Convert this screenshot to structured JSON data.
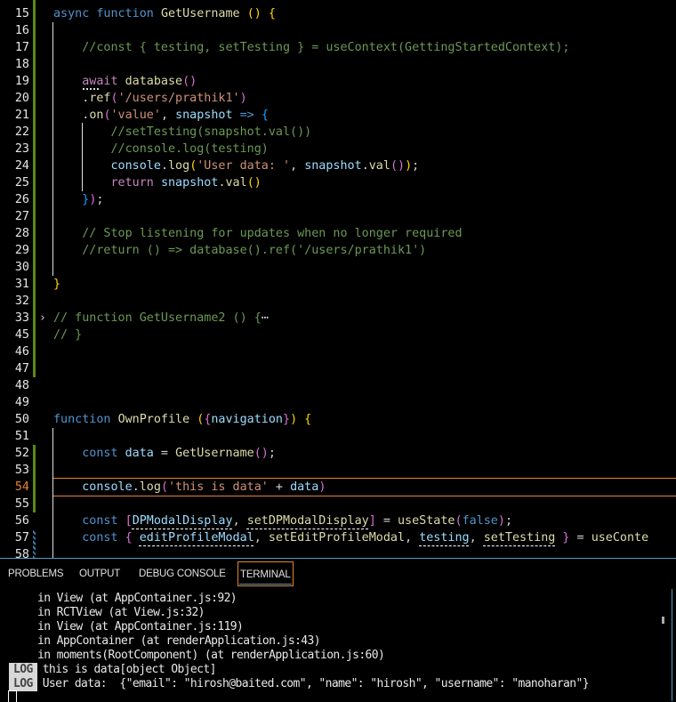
{
  "editor": {
    "active_line": "54",
    "lines": [
      {
        "n": "15",
        "tokens": [
          [
            "k",
            "async "
          ],
          [
            "k",
            "function "
          ],
          [
            "f",
            "GetUsername "
          ],
          [
            "p",
            "() {"
          ]
        ]
      },
      {
        "n": "16",
        "tokens": []
      },
      {
        "n": "17",
        "tokens": [
          [
            "c",
            "    //const { testing, setTesting } = useContext(GettingStartedContext);"
          ]
        ]
      },
      {
        "n": "18",
        "tokens": []
      },
      {
        "n": "19",
        "tokens": [
          [
            "w",
            "    "
          ],
          [
            "ctl",
            "await"
          ],
          [
            "w",
            " "
          ],
          [
            "f",
            "database"
          ],
          [
            "pp",
            "()"
          ]
        ]
      },
      {
        "n": "20",
        "tokens": [
          [
            "w",
            "    ."
          ],
          [
            "f",
            "ref"
          ],
          [
            "pp",
            "("
          ],
          [
            "s",
            "'/users/prathik1'"
          ],
          [
            "pp",
            ")"
          ]
        ]
      },
      {
        "n": "21",
        "tokens": [
          [
            "w",
            "    ."
          ],
          [
            "f",
            "on"
          ],
          [
            "pp",
            "("
          ],
          [
            "s",
            "'value'"
          ],
          [
            "w",
            ", "
          ],
          [
            "v",
            "snapshot"
          ],
          [
            "w",
            " "
          ],
          [
            "k",
            "=>"
          ],
          [
            "w",
            " "
          ],
          [
            "pb",
            "{"
          ]
        ]
      },
      {
        "n": "22",
        "tokens": [
          [
            "c",
            "        //setTesting(snapshot.val())"
          ]
        ]
      },
      {
        "n": "23",
        "tokens": [
          [
            "c",
            "        //console.log(testing)"
          ]
        ]
      },
      {
        "n": "24",
        "tokens": [
          [
            "w",
            "        "
          ],
          [
            "v",
            "console"
          ],
          [
            "w",
            "."
          ],
          [
            "f",
            "log"
          ],
          [
            "p",
            "("
          ],
          [
            "s",
            "'User data: '"
          ],
          [
            "w",
            ", "
          ],
          [
            "v",
            "snapshot"
          ],
          [
            "w",
            "."
          ],
          [
            "f",
            "val"
          ],
          [
            "pp",
            "()"
          ],
          [
            "p",
            ")"
          ],
          [
            "w",
            ";"
          ]
        ]
      },
      {
        "n": "25",
        "tokens": [
          [
            "w",
            "        "
          ],
          [
            "ctl",
            "return"
          ],
          [
            "w",
            " "
          ],
          [
            "v",
            "snapshot"
          ],
          [
            "w",
            "."
          ],
          [
            "f",
            "val"
          ],
          [
            "p",
            "()"
          ]
        ]
      },
      {
        "n": "26",
        "tokens": [
          [
            "w",
            "    "
          ],
          [
            "pb",
            "}"
          ],
          [
            "pp",
            ")"
          ],
          [
            "w",
            ";"
          ]
        ]
      },
      {
        "n": "27",
        "tokens": []
      },
      {
        "n": "28",
        "tokens": [
          [
            "c",
            "    // Stop listening for updates when no longer required"
          ]
        ]
      },
      {
        "n": "29",
        "tokens": [
          [
            "c",
            "    //return () => database().ref('/users/prathik1')"
          ]
        ]
      },
      {
        "n": "30",
        "tokens": []
      },
      {
        "n": "31",
        "tokens": [
          [
            "p",
            "}"
          ]
        ]
      },
      {
        "n": "32",
        "tokens": []
      },
      {
        "n": "33",
        "tokens": [
          [
            "c",
            "// function GetUsername2 () {"
          ],
          [
            "w",
            "⋯"
          ]
        ],
        "folded": true
      },
      {
        "n": "45",
        "tokens": [
          [
            "c",
            "// }"
          ]
        ]
      },
      {
        "n": "46",
        "tokens": []
      },
      {
        "n": "47",
        "tokens": []
      },
      {
        "n": "48",
        "tokens": []
      },
      {
        "n": "49",
        "tokens": []
      },
      {
        "n": "50",
        "tokens": [
          [
            "k",
            "function "
          ],
          [
            "f",
            "OwnProfile "
          ],
          [
            "p",
            "("
          ],
          [
            "pp",
            "{"
          ],
          [
            "v",
            "navigation"
          ],
          [
            "pp",
            "}"
          ],
          [
            "p",
            ") {"
          ]
        ]
      },
      {
        "n": "51",
        "tokens": []
      },
      {
        "n": "52",
        "tokens": [
          [
            "w",
            "    "
          ],
          [
            "k",
            "const "
          ],
          [
            "v",
            "data"
          ],
          [
            "w",
            " = "
          ],
          [
            "f",
            "GetUsername"
          ],
          [
            "pp",
            "()"
          ],
          [
            "w",
            ";"
          ]
        ]
      },
      {
        "n": "53",
        "tokens": []
      },
      {
        "n": "54",
        "tokens": [
          [
            "w",
            "    "
          ],
          [
            "v",
            "console"
          ],
          [
            "w",
            "."
          ],
          [
            "f",
            "log"
          ],
          [
            "pp",
            "("
          ],
          [
            "s",
            "'this is data'"
          ],
          [
            "w",
            " + "
          ],
          [
            "v",
            "data"
          ],
          [
            "pp",
            ")"
          ]
        ]
      },
      {
        "n": "55",
        "tokens": []
      },
      {
        "n": "56",
        "tokens": [
          [
            "w",
            "    "
          ],
          [
            "k",
            "const "
          ],
          [
            "pp",
            "["
          ],
          [
            "v",
            "DPModalDisplay"
          ],
          [
            "w",
            ", "
          ],
          [
            "f",
            "setDPModalDisplay"
          ],
          [
            "pp",
            "]"
          ],
          [
            "w",
            " = "
          ],
          [
            "f",
            "useState"
          ],
          [
            "pp",
            "("
          ],
          [
            "k",
            "false"
          ],
          [
            "pp",
            ")"
          ],
          [
            "w",
            ";"
          ]
        ]
      },
      {
        "n": "57",
        "tokens": [
          [
            "w",
            "    "
          ],
          [
            "k",
            "const "
          ],
          [
            "pp",
            "{ "
          ],
          [
            "v",
            "editProfileModal"
          ],
          [
            "w",
            ", "
          ],
          [
            "f",
            "setEditProfileModal"
          ],
          [
            "w",
            ", "
          ],
          [
            "v",
            "testing"
          ],
          [
            "w",
            ", "
          ],
          [
            "f",
            "setTesting"
          ],
          [
            "pp",
            " }"
          ],
          [
            "w",
            " = "
          ],
          [
            "f",
            "useConte"
          ]
        ]
      },
      {
        "n": "58",
        "tokens": []
      }
    ]
  },
  "panel": {
    "tabs": [
      {
        "label": "PROBLEMS",
        "active": false
      },
      {
        "label": "OUTPUT",
        "active": false
      },
      {
        "label": "DEBUG CONSOLE",
        "active": false
      },
      {
        "label": "TERMINAL",
        "active": true
      }
    ]
  },
  "terminal": {
    "lines": [
      {
        "text": "in View (at AppContainer.js:92)"
      },
      {
        "text": "in RCTView (at View.js:32)"
      },
      {
        "text": "in View (at AppContainer.js:119)"
      },
      {
        "text": "in AppContainer (at renderApplication.js:43)"
      },
      {
        "text": "in moments(RootComponent) (at renderApplication.js:60)"
      },
      {
        "badge": "LOG",
        "text": "this is data[object Object]"
      },
      {
        "badge": "LOG",
        "text": "User data:  {\"email\": \"hirosh@baited.com\", \"name\": \"hirosh\", \"username\": \"manoharan\"}"
      }
    ]
  }
}
